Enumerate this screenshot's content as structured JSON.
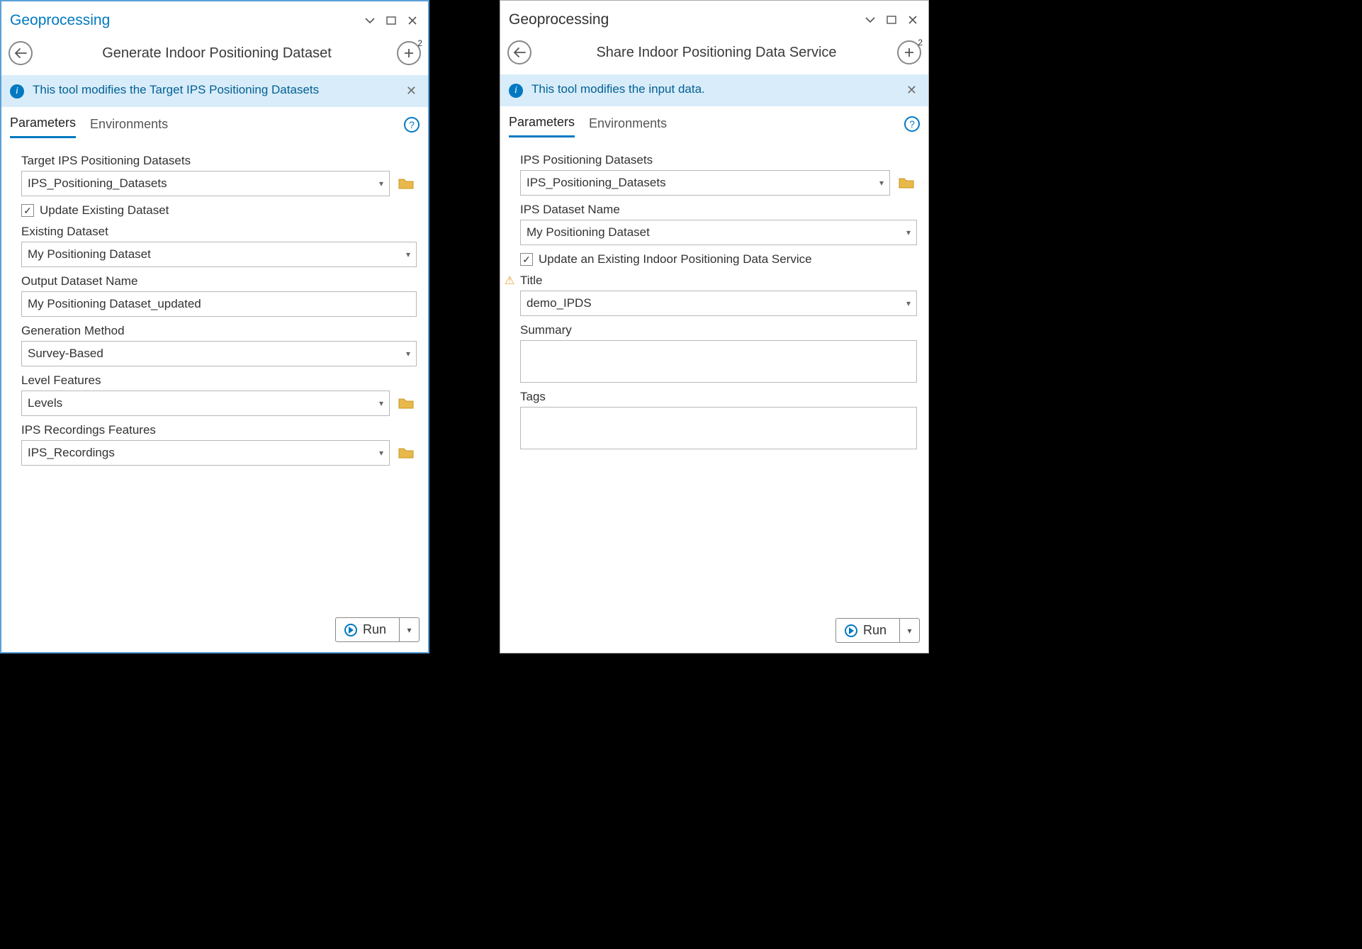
{
  "left": {
    "window_title": "Geoprocessing",
    "tool_title": "Generate Indoor Positioning Dataset",
    "plus_badge": "2",
    "banner": "This tool modifies the Target IPS Positioning Datasets",
    "tabs": {
      "parameters": "Parameters",
      "environments": "Environments"
    },
    "fields": {
      "target_label": "Target IPS Positioning Datasets",
      "target_value": "IPS_Positioning_Datasets",
      "update_checkbox": "Update Existing Dataset",
      "existing_label": "Existing Dataset",
      "existing_value": "My Positioning Dataset",
      "output_label": "Output Dataset Name",
      "output_value": "My Positioning Dataset_updated",
      "genmethod_label": "Generation Method",
      "genmethod_value": "Survey-Based",
      "level_label": "Level Features",
      "level_value": "Levels",
      "recordings_label": "IPS Recordings Features",
      "recordings_value": "IPS_Recordings"
    },
    "run_label": "Run"
  },
  "right": {
    "window_title": "Geoprocessing",
    "tool_title": "Share Indoor Positioning Data Service",
    "plus_badge": "2",
    "banner": "This tool modifies the input data.",
    "tabs": {
      "parameters": "Parameters",
      "environments": "Environments"
    },
    "fields": {
      "ips_label": "IPS Positioning Datasets",
      "ips_value": "IPS_Positioning_Datasets",
      "name_label": "IPS Dataset Name",
      "name_value": "My Positioning Dataset",
      "update_checkbox": "Update an Existing Indoor Positioning Data Service",
      "title_label": "Title",
      "title_value": "demo_IPDS",
      "summary_label": "Summary",
      "summary_value": "",
      "tags_label": "Tags",
      "tags_value": ""
    },
    "run_label": "Run"
  }
}
